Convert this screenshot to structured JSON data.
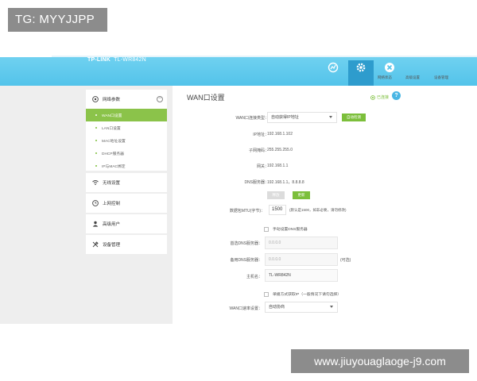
{
  "watermark": {
    "top_left": "TG: MYYJJPP",
    "bottom_right": "www.jiuyouaglaoge-j9.com"
  },
  "header": {
    "brand": "TP-LINK",
    "model": "TL-WR842N",
    "nav": [
      {
        "label": "网络状态",
        "icon": "network-status-icon"
      },
      {
        "label": "高级设置",
        "icon": "gear-icon",
        "active": true
      },
      {
        "label": "设备管理",
        "icon": "close-icon"
      }
    ]
  },
  "sidebar": {
    "network": {
      "label": "网络参数",
      "items": [
        "WAN口设置",
        "LAN口设置",
        "MAC地址设置",
        "DHCP服务器",
        "IP与MAC绑定"
      ]
    },
    "sections": [
      {
        "label": "无线设置",
        "icon": "wifi-icon"
      },
      {
        "label": "上网控制",
        "icon": "control-icon"
      },
      {
        "label": "高级用户",
        "icon": "user-icon"
      },
      {
        "label": "设备管理",
        "icon": "tools-icon"
      }
    ]
  },
  "main": {
    "title": "WAN口设置",
    "help_link": "已连接",
    "help_button": "?",
    "conn_type_label": "WAN口连接类型：",
    "conn_type_value": "自动获得IP地址",
    "conn_type_btn": "自动检测",
    "ip_label": "IP地址：",
    "ip_value": "192.168.1.102",
    "mask_label": "子网掩码：",
    "mask_value": "255.255.255.0",
    "gateway_label": "网关：",
    "gateway_value": "192.168.1.1",
    "dns_label": "DNS服务器：",
    "dns_value": "192.168.1.1，8.8.8.8",
    "release_btn": "释放",
    "renew_btn": "更新",
    "mtu_label": "数据包MTU(字节)：",
    "mtu_value": "1500",
    "mtu_hint": "(默认是1500，如非必要，请勿修改)",
    "manual_dns_check": "手动设置DNS服务器",
    "primary_dns_label": "首选DNS服务器：",
    "primary_dns_placeholder": "0.0.0.0",
    "secondary_dns_label": "备用DNS服务器：",
    "secondary_dns_placeholder": "0.0.0.0",
    "secondary_dns_suffix": "(可选)",
    "hostname_label": "主机名：",
    "hostname_value": "TL-WR842N",
    "unicast_check": "单播方式获取IP（一般情况下请勿选择）",
    "wan_speed_label": "WAN口速率设置：",
    "wan_speed_value": "自动协商"
  },
  "colors": {
    "header": "#53c3ea",
    "active_nav": "#2e9ccd",
    "green": "#7cbf3b",
    "sidebar_bg": "#eeeeee"
  }
}
